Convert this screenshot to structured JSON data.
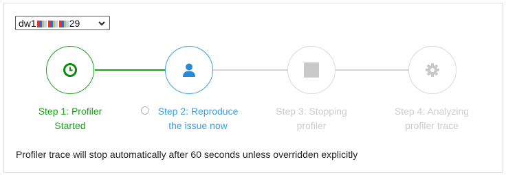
{
  "machine_select": {
    "prefix": "dw1",
    "suffix": "29",
    "icon": "chevron-down-icon"
  },
  "colors": {
    "completed": "#1aa31a",
    "active": "#3aa0e0",
    "pending": "#c9c9c9",
    "pending_text": "#cccccc"
  },
  "steps": [
    {
      "line1": "Step 1: Profiler",
      "line2": "Started",
      "state": "completed",
      "icon": "clock-icon"
    },
    {
      "line1": "Step 2: Reproduce",
      "line2": "the issue now",
      "state": "active",
      "icon": "user-icon"
    },
    {
      "line1": "Step 3: Stopping",
      "line2": "profiler",
      "state": "pending",
      "icon": "stop-icon"
    },
    {
      "line1": "Step 4: Analyzing",
      "line2": "profiler trace",
      "state": "pending",
      "icon": "gear-icon"
    }
  ],
  "info_text": "Profiler trace will stop automatically after 60 seconds unless overridden explicitly"
}
